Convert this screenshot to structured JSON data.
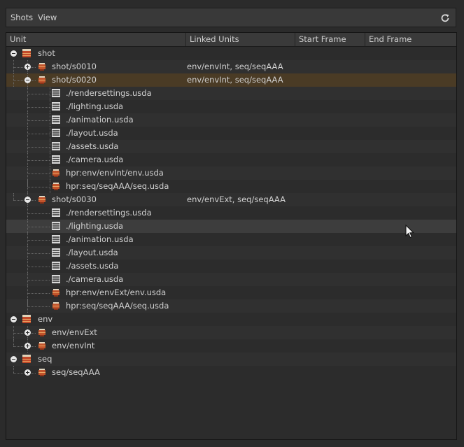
{
  "menu": {
    "shots": "Shots",
    "view": "View"
  },
  "columns": {
    "unit": "Unit",
    "linked": "Linked Units",
    "start": "Start Frame",
    "end": "End Frame"
  },
  "rows": [
    {
      "label": "shot",
      "linked": "",
      "depth": 0,
      "toggle": "minus",
      "icon": "stack"
    },
    {
      "label": "shot/s0010",
      "linked": "env/envInt, seq/seqAAA",
      "depth": 1,
      "toggle": "plus",
      "icon": "unit"
    },
    {
      "label": "shot/s0020",
      "linked": "env/envInt, seq/seqAAA",
      "depth": 1,
      "toggle": "minus",
      "icon": "unit",
      "selected": true
    },
    {
      "label": "./rendersettings.usda",
      "linked": "",
      "depth": 2,
      "toggle": null,
      "icon": "layer"
    },
    {
      "label": "./lighting.usda",
      "linked": "",
      "depth": 2,
      "toggle": null,
      "icon": "layer"
    },
    {
      "label": "./animation.usda",
      "linked": "",
      "depth": 2,
      "toggle": null,
      "icon": "layer"
    },
    {
      "label": "./layout.usda",
      "linked": "",
      "depth": 2,
      "toggle": null,
      "icon": "layer"
    },
    {
      "label": "./assets.usda",
      "linked": "",
      "depth": 2,
      "toggle": null,
      "icon": "layer"
    },
    {
      "label": "./camera.usda",
      "linked": "",
      "depth": 2,
      "toggle": null,
      "icon": "layer"
    },
    {
      "label": "hpr:env/envInt/env.usda",
      "linked": "",
      "depth": 2,
      "toggle": null,
      "icon": "unit"
    },
    {
      "label": "hpr:seq/seqAAA/seq.usda",
      "linked": "",
      "depth": 2,
      "toggle": null,
      "icon": "unit"
    },
    {
      "label": "shot/s0030",
      "linked": "env/envExt, seq/seqAAA",
      "depth": 1,
      "toggle": "minus",
      "icon": "unit"
    },
    {
      "label": "./rendersettings.usda",
      "linked": "",
      "depth": 2,
      "toggle": null,
      "icon": "layer"
    },
    {
      "label": "./lighting.usda",
      "linked": "",
      "depth": 2,
      "toggle": null,
      "icon": "layer",
      "hover": true
    },
    {
      "label": "./animation.usda",
      "linked": "",
      "depth": 2,
      "toggle": null,
      "icon": "layer"
    },
    {
      "label": "./layout.usda",
      "linked": "",
      "depth": 2,
      "toggle": null,
      "icon": "layer"
    },
    {
      "label": "./assets.usda",
      "linked": "",
      "depth": 2,
      "toggle": null,
      "icon": "layer"
    },
    {
      "label": "./camera.usda",
      "linked": "",
      "depth": 2,
      "toggle": null,
      "icon": "layer"
    },
    {
      "label": "hpr:env/envExt/env.usda",
      "linked": "",
      "depth": 2,
      "toggle": null,
      "icon": "unit"
    },
    {
      "label": "hpr:seq/seqAAA/seq.usda",
      "linked": "",
      "depth": 2,
      "toggle": null,
      "icon": "unit"
    },
    {
      "label": "env",
      "linked": "",
      "depth": 0,
      "toggle": "minus",
      "icon": "stack"
    },
    {
      "label": "env/envExt",
      "linked": "",
      "depth": 1,
      "toggle": "plus",
      "icon": "unit"
    },
    {
      "label": "env/envInt",
      "linked": "",
      "depth": 1,
      "toggle": "plus",
      "icon": "unit"
    },
    {
      "label": "seq",
      "linked": "",
      "depth": 0,
      "toggle": "minus",
      "icon": "stack"
    },
    {
      "label": "seq/seqAAA",
      "linked": "",
      "depth": 1,
      "toggle": "plus",
      "icon": "unit"
    }
  ],
  "colors": {
    "selected_row": "#4a3b25",
    "accent_icon": "#c8603a",
    "background": "#2b2b2b"
  }
}
